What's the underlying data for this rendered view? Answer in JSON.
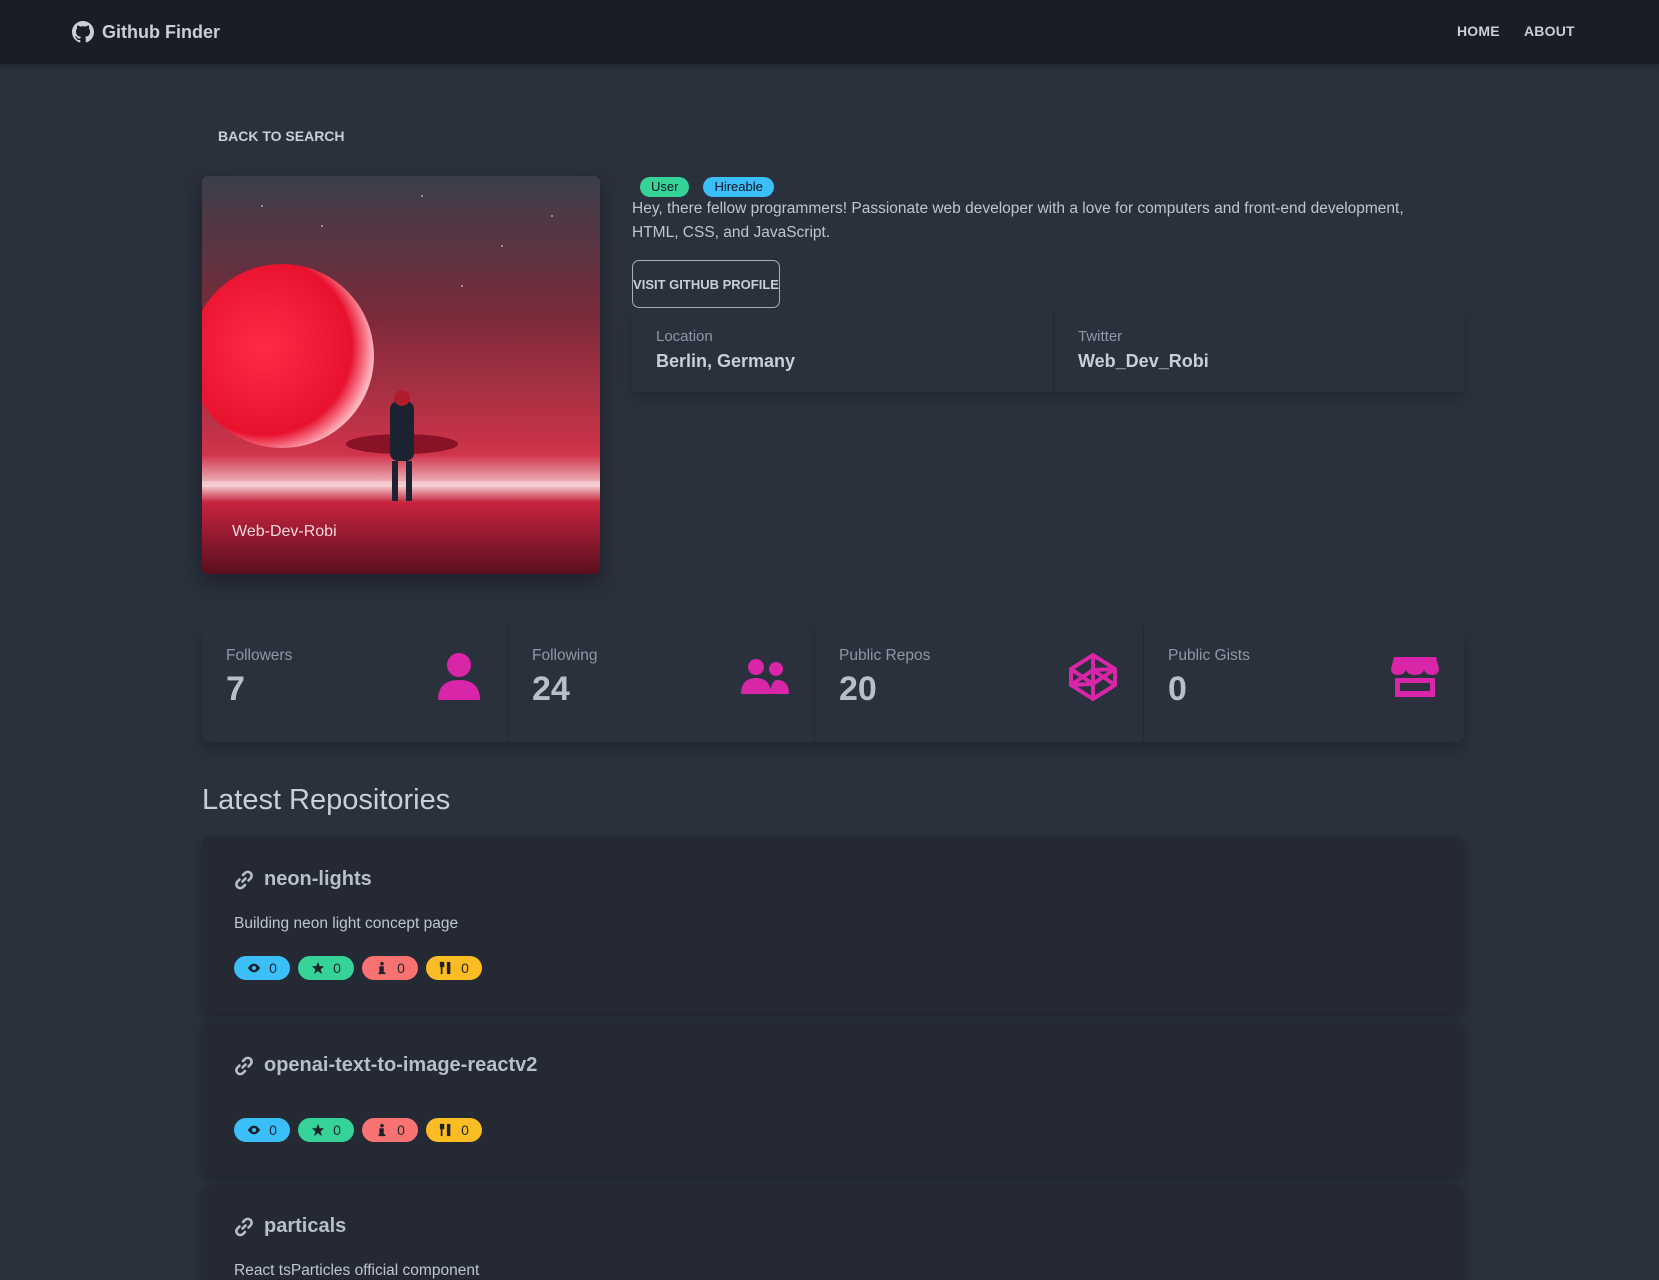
{
  "navbar": {
    "brand": "Github Finder",
    "links": [
      "HOME",
      "ABOUT"
    ]
  },
  "back_link": "BACK TO SEARCH",
  "profile": {
    "avatar_name": "Web-Dev-Robi",
    "badges": [
      "User",
      "Hireable"
    ],
    "bio": "Hey, there fellow programmers! Passionate web developer with a love for computers and front-end development, HTML, CSS, and JavaScript.",
    "visit_button": "VISIT GITHUB PROFILE",
    "info": [
      {
        "label": "Location",
        "value": "Berlin, Germany"
      },
      {
        "label": "Twitter",
        "value": "Web_Dev_Robi"
      }
    ]
  },
  "counts": [
    {
      "label": "Followers",
      "value": "7",
      "icon": "user-icon"
    },
    {
      "label": "Following",
      "value": "24",
      "icon": "users-icon"
    },
    {
      "label": "Public Repos",
      "value": "20",
      "icon": "codepen-icon"
    },
    {
      "label": "Public Gists",
      "value": "0",
      "icon": "store-icon"
    }
  ],
  "repos_title": "Latest Repositories",
  "repos": [
    {
      "name": "neon-lights",
      "description": "Building neon light concept page",
      "watchers": "0",
      "stars": "0",
      "issues": "0",
      "forks": "0"
    },
    {
      "name": "openai-text-to-image-reactv2",
      "description": "",
      "watchers": "0",
      "stars": "0",
      "issues": "0",
      "forks": "0"
    },
    {
      "name": "particals",
      "description": "React tsParticles official component"
    }
  ],
  "colors": {
    "background": "#2a303c",
    "navbar": "#191d24",
    "accent": "#d926a9",
    "info": "#3abff8",
    "success": "#36d399",
    "error": "#f87272",
    "warning": "#fbbd23"
  }
}
